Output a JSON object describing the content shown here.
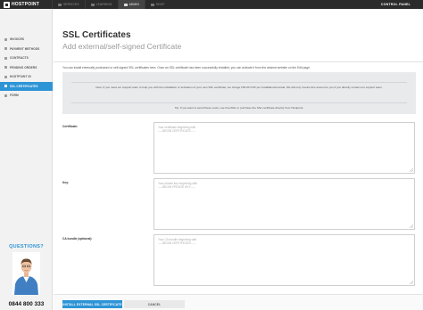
{
  "topbar": {
    "brand": "HOSTPOINT",
    "tabs": [
      "SERVICES",
      "LEARNING",
      "ADMIN",
      "SHOP"
    ],
    "active_tab": "ADMIN",
    "control_panel": "CONTROL PANEL"
  },
  "sidebar": {
    "items": [
      {
        "label": "INVOICES",
        "icon": "document-icon",
        "active": false
      },
      {
        "label": "PAYMENT METHODS",
        "icon": "credit-card-icon",
        "active": false
      },
      {
        "label": "CONTRACTS",
        "icon": "contract-icon",
        "active": false
      },
      {
        "label": "PENDING ORDERS",
        "icon": "cart-icon",
        "active": false
      },
      {
        "label": "HOSTPOINT ID",
        "icon": "id-icon",
        "active": false
      },
      {
        "label": "SSL CERTIFICATES",
        "icon": "lock-icon",
        "active": true
      },
      {
        "label": "FORM",
        "icon": "form-icon",
        "active": false
      }
    ],
    "promo": {
      "title": "QUESTIONS?",
      "phone": "0844 800 333"
    }
  },
  "page": {
    "title": "SSL Certificates",
    "subtitle": "Add external/self-signed Certificate",
    "intro": "You can install externally purchased or self-signed SSL certificates here. Once an SSL certificate has been successfully installed, you can activate it from the desired website on the Edit page.",
    "notice": {
      "line1": "Note: If you need our support team to help you with the installation or activation of your own SSL certificate, we charge 150.00 CHF per installation/renewal. We will only invoice this amount to you if you directly contact our support team.",
      "line2": "Tip: If you want to avoid these costs, use FreeSSL or purchase the SSL certificate directly from Hostpoint."
    }
  },
  "form": {
    "certificate": {
      "label": "Certificate:",
      "placeholder_line1": "Your certificate beginning with",
      "placeholder_line2": "-----BEGIN CERTIFICATE-----"
    },
    "key": {
      "label": "Key:",
      "placeholder_line1": "Your private key beginning with",
      "placeholder_line2": "-----BEGIN PRIVATE KEY-----"
    },
    "ca_bundle": {
      "label": "CA bundle (optional):",
      "placeholder_line1": "Your CA bundle beginning with",
      "placeholder_line2": "-----BEGIN CERTIFICATE-----"
    }
  },
  "buttons": {
    "install": "INSTALL EXTERNAL SSL CERTIFICATE",
    "cancel": "CANCEL"
  },
  "colors": {
    "accent": "#2d94d6",
    "topbar": "#2b2b2b",
    "sidebar": "#f2f2f2"
  }
}
